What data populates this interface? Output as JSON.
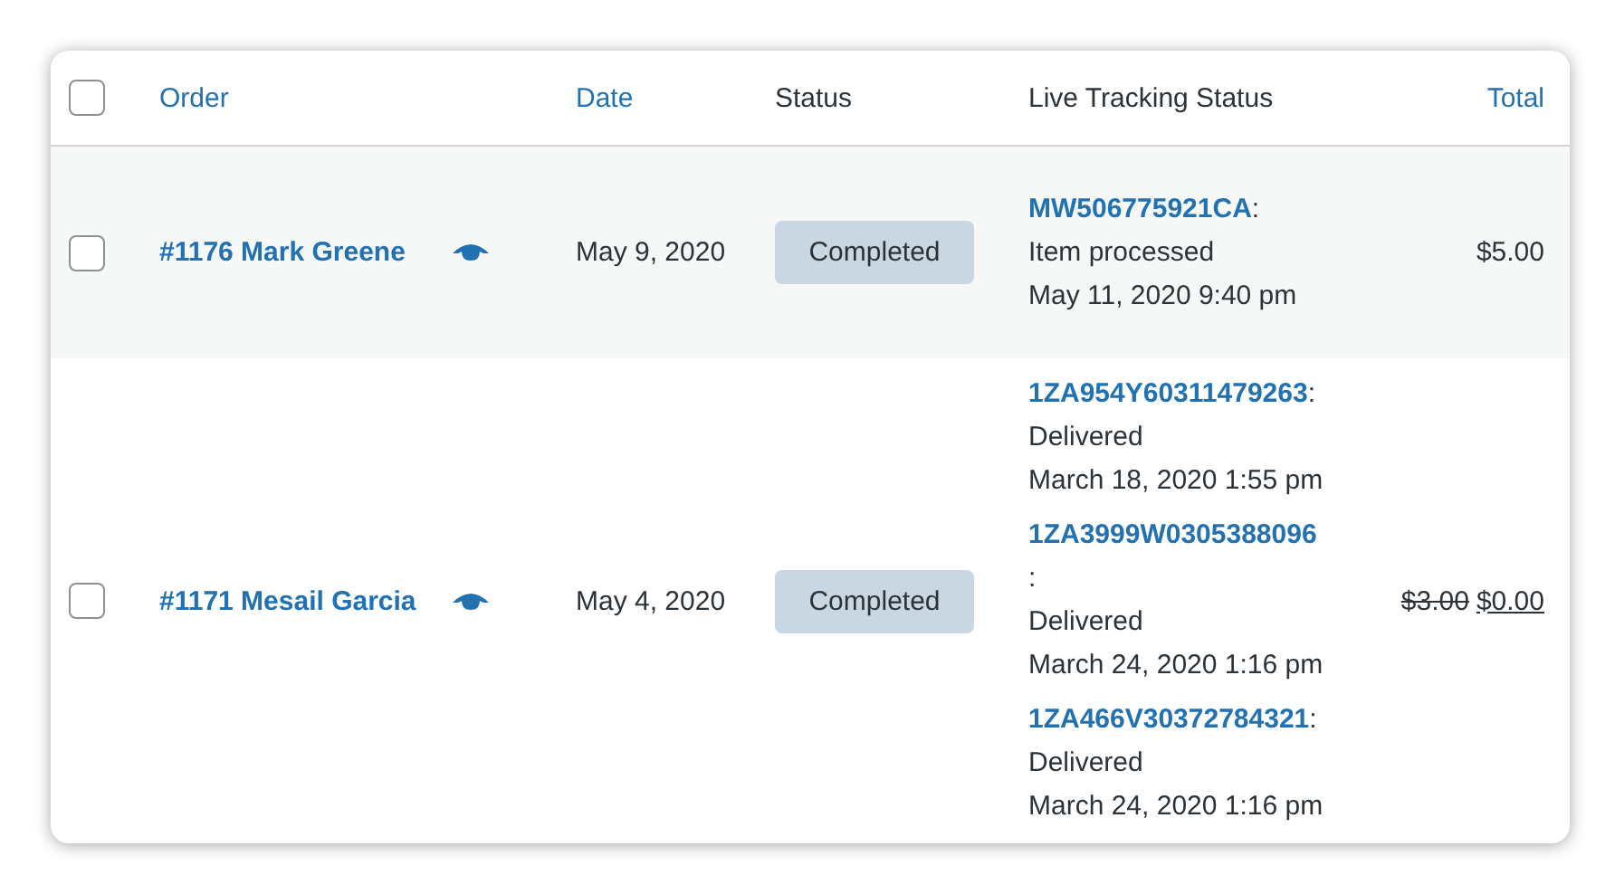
{
  "table": {
    "select_all": {
      "checked": false
    },
    "columns": [
      {
        "label": "Order",
        "sortable": true
      },
      {
        "label": "Date",
        "sortable": true
      },
      {
        "label": "Status",
        "sortable": false
      },
      {
        "label": "Live Tracking Status",
        "sortable": false
      },
      {
        "label": "Total",
        "sortable": true
      }
    ],
    "rows": [
      {
        "selected": false,
        "order": "#1176 Mark Greene",
        "date": "May 9, 2020",
        "status": "Completed",
        "tracking": [
          {
            "kind": "inline",
            "number": "MW506775921CA",
            "separator": ":",
            "status": "Item processed",
            "time": "May 11, 2020 9:40 pm"
          }
        ],
        "total": [
          {
            "kind": "regular",
            "text": "$5.00"
          }
        ]
      },
      {
        "selected": false,
        "order": "#1171 Mesail Garcia",
        "date": "May 4, 2020",
        "status": "Completed",
        "tracking": [
          {
            "kind": "inline",
            "number": "1ZA954Y60311479263",
            "separator": ":",
            "status": "Delivered",
            "time": "March 18, 2020 1:55 pm"
          },
          {
            "kind": "break",
            "number": "1ZA3999W0305388096",
            "separator": ":",
            "status": "Delivered",
            "time": "March 24, 2020 1:16 pm"
          },
          {
            "kind": "inline",
            "number": "1ZA466V30372784321",
            "separator": ":",
            "status": "Delivered",
            "time": "March 24, 2020 1:16 pm"
          }
        ],
        "total": [
          {
            "kind": "struck",
            "text": "$3.00"
          },
          {
            "kind": "sale",
            "text": "$0.00"
          }
        ]
      }
    ]
  }
}
